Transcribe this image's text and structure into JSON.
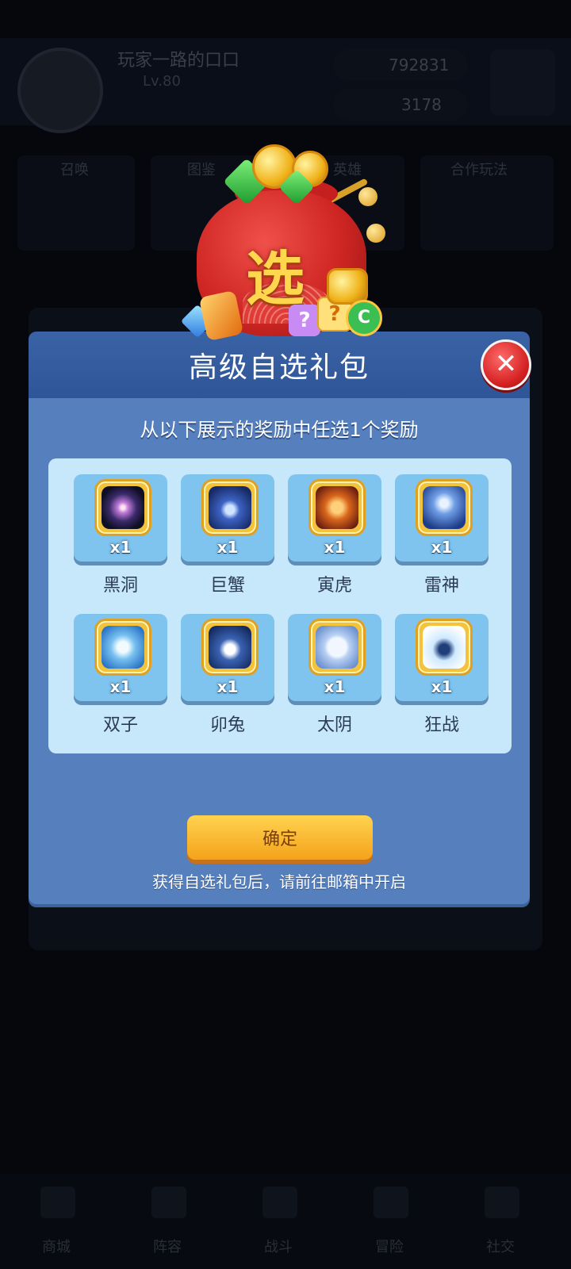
{
  "background": {
    "player_name": "玩家一路的口口",
    "level": "Lv.80",
    "coins": "792831",
    "gems": "3178",
    "row_labels": [
      "召唤",
      "图鉴",
      "英雄",
      "合作玩法"
    ],
    "nav": [
      "商城",
      "阵容",
      "战斗",
      "冒险",
      "社交"
    ]
  },
  "bag": {
    "char": "选",
    "dice_q": "?",
    "hex_c": "C"
  },
  "dialog": {
    "title": "高级自选礼包",
    "close": "✕",
    "subtitle": "从以下展示的奖励中任选1个奖励",
    "items": [
      {
        "name": "黑洞",
        "qty": "x1",
        "icon": "black-hole-icon"
      },
      {
        "name": "巨蟹",
        "qty": "x1",
        "icon": "crab-icon"
      },
      {
        "name": "寅虎",
        "qty": "x1",
        "icon": "tiger-icon"
      },
      {
        "name": "雷神",
        "qty": "x1",
        "icon": "thunder-hammer-icon"
      },
      {
        "name": "双子",
        "qty": "x1",
        "icon": "gemini-icon"
      },
      {
        "name": "卯兔",
        "qty": "x1",
        "icon": "rabbit-icon"
      },
      {
        "name": "太阴",
        "qty": "x1",
        "icon": "moon-icon"
      },
      {
        "name": "狂战",
        "qty": "x1",
        "icon": "berserker-icon"
      }
    ],
    "confirm_label": "确定",
    "footer_note": "获得自选礼包后，请前往邮箱中开启"
  }
}
